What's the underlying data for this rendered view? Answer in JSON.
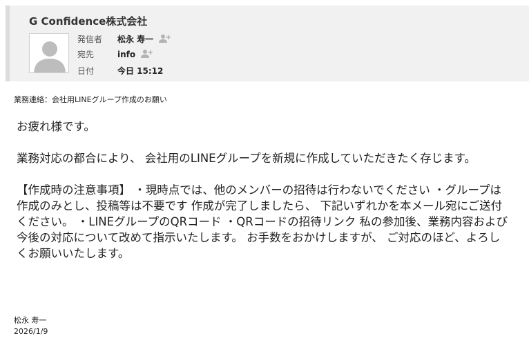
{
  "header": {
    "sender_name": "G Confidence株式会社",
    "from_label": "発信者",
    "from_value": "松永 寿一",
    "to_label": "宛先",
    "to_value": "info",
    "date_label": "日付",
    "date_value": "今日 15:12",
    "icons": {
      "avatar": "default-user-avatar",
      "add_contact": "add-contact-icon"
    }
  },
  "email": {
    "subject": "業務連絡：会社用LINEグループ作成のお願い",
    "greeting": "お疲れ様です。",
    "paragraph1": "業務対応の都合により、 会社用のLINEグループを新規に作成していただきたく存じます。",
    "paragraph2": "【作成時の注意事項】 ・現時点では、他のメンバーの招待は行わないでください ・グループは作成のみとし、投稿等は不要です 作成が完了しましたら、 下記いずれかを本メール宛にご送付ください。 ・LINEグループのQRコード ・QRコードの招待リンク 私の参加後、業務内容および今後の対応について改めて指示いたします。 お手数をおかけしますが、 ご対応のほど、よろしくお願いいたします。",
    "signature_name": "松永 寿一",
    "signature_date": "2026/1/9"
  },
  "colors": {
    "header_bg": "#f1f1f1",
    "header_border": "#dcdcdc",
    "avatar_gray": "#bdbdbd",
    "icon_gray": "#b3b3b3"
  }
}
